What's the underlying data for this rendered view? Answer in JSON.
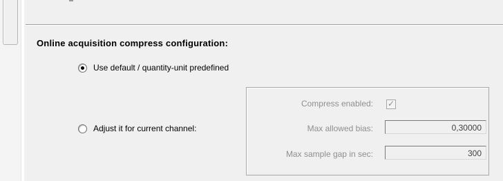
{
  "section": {
    "title": "Online acquisition compress configuration:"
  },
  "options": {
    "use_default_label": "Use default / quantity-unit predefined",
    "adjust_label": "Adjust it for current channel:",
    "selected": "use_default"
  },
  "fields": {
    "compress_enabled_label": "Compress enabled:",
    "compress_enabled_checked": true,
    "max_bias_label": "Max allowed bias:",
    "max_bias_value": "0,30000",
    "max_gap_label": "Max sample gap in sec:",
    "max_gap_value": "300"
  },
  "colors": {
    "panel_bg": "#f0f0f0",
    "disabled_text": "#8f8f8f"
  }
}
